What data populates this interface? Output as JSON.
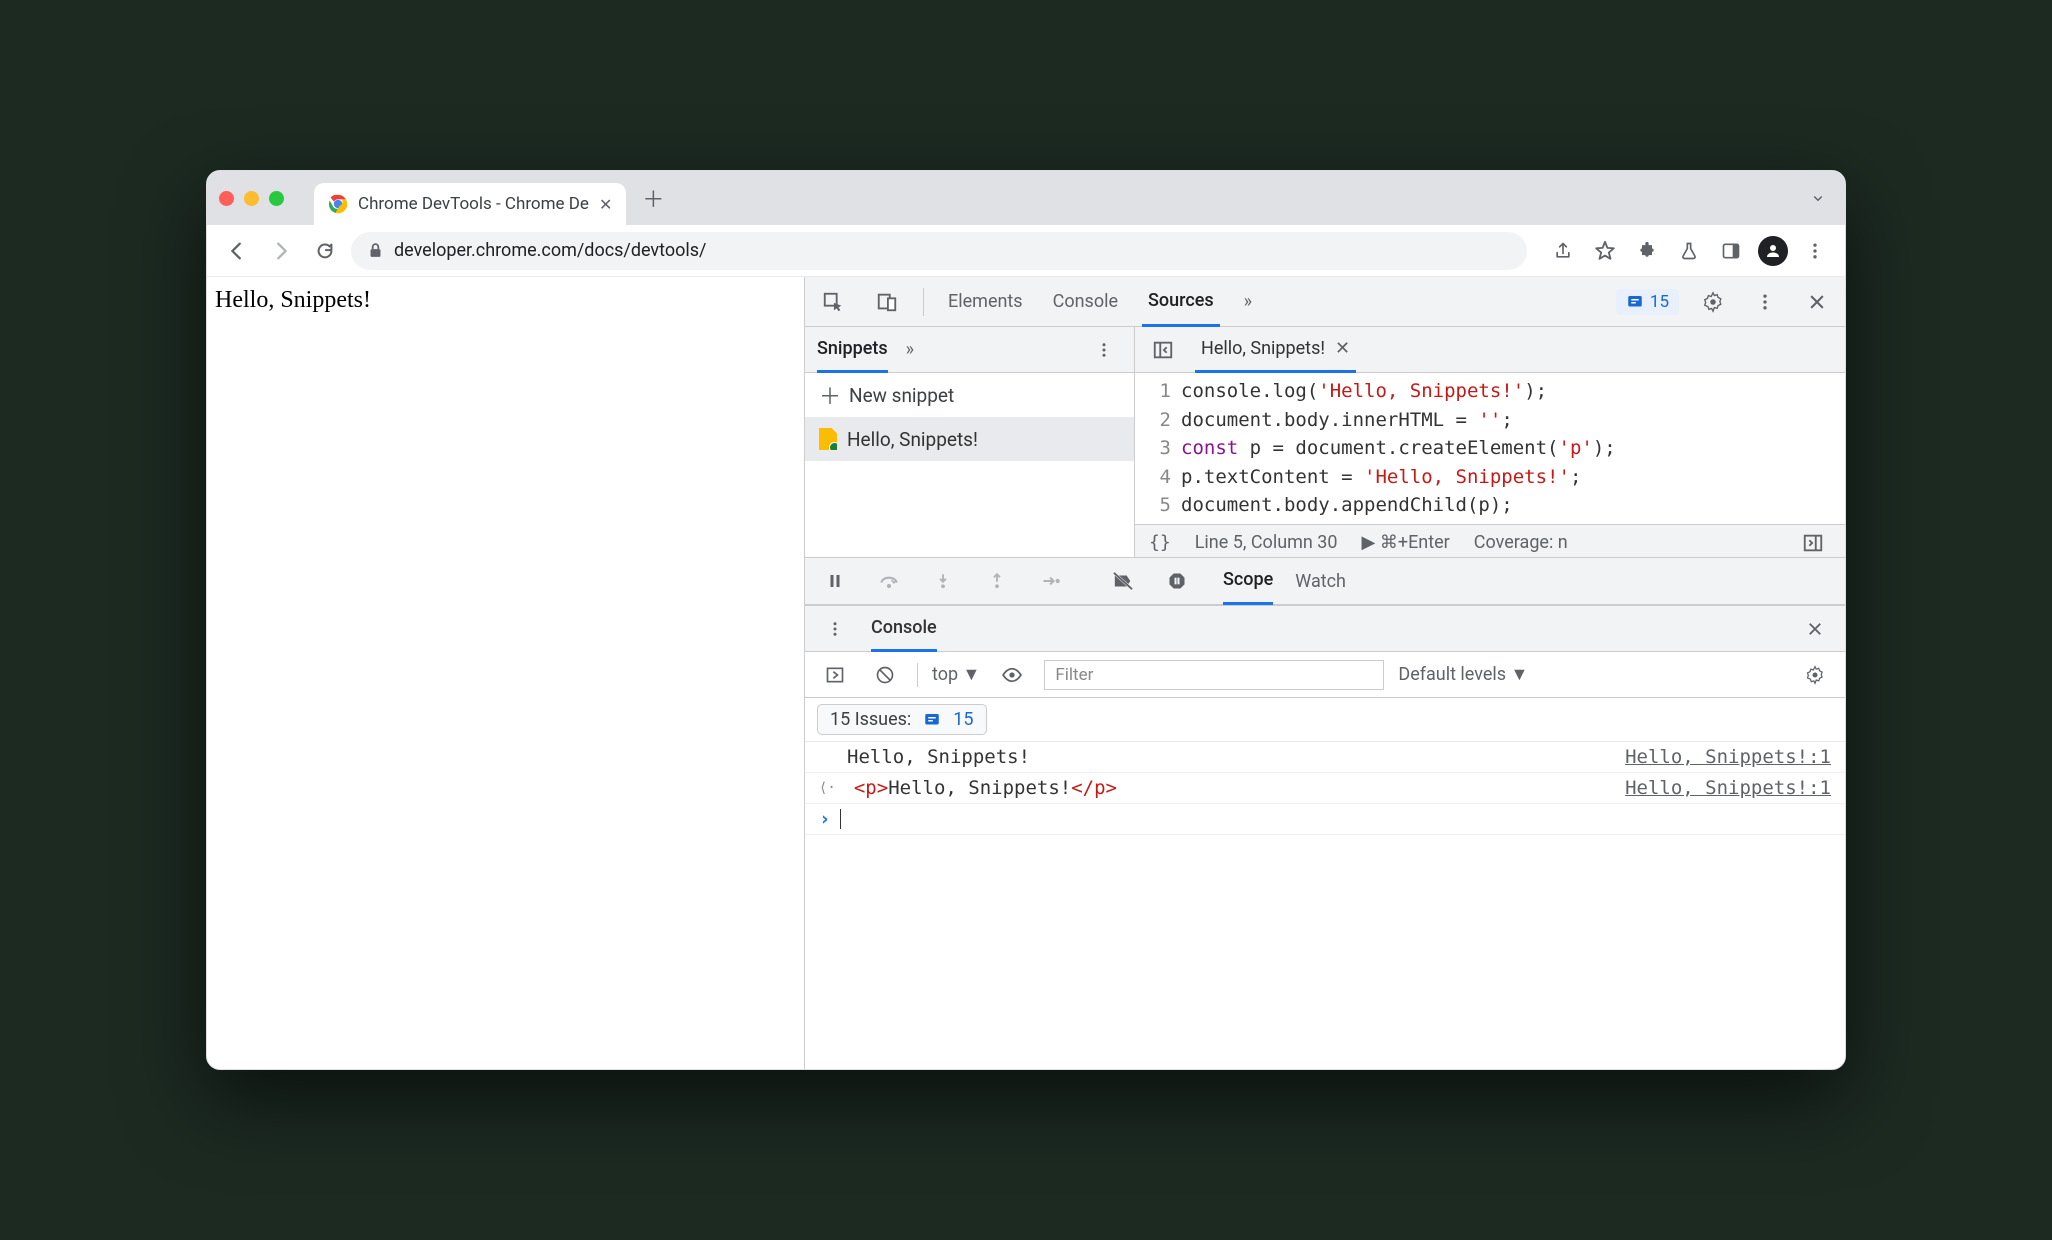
{
  "browser": {
    "tab_title": "Chrome DevTools - Chrome De",
    "new_tab_icon": "plus",
    "url": "developer.chrome.com/docs/devtools/"
  },
  "page": {
    "body_text": "Hello, Snippets!"
  },
  "devtools": {
    "tabs": {
      "elements": "Elements",
      "console": "Console",
      "sources": "Sources",
      "more": "»"
    },
    "issues_count": "15",
    "snippets": {
      "tab_label": "Snippets",
      "new_snippet": "New snippet",
      "items": [
        "Hello, Snippets!"
      ]
    },
    "editor": {
      "open_file": "Hello, Snippets!",
      "lines": [
        {
          "n": "1",
          "pre": "console.log(",
          "str": "'Hello, Snippets!'",
          "post": ");"
        },
        {
          "n": "2",
          "pre": "document.body.innerHTML = ",
          "str": "''",
          "post": ";"
        },
        {
          "n": "3",
          "kw": "const",
          "mid": " p = document.createElement(",
          "str": "'p'",
          "post": ");"
        },
        {
          "n": "4",
          "pre": "p.textContent = ",
          "str": "'Hello, Snippets!'",
          "post": ";"
        },
        {
          "n": "5",
          "pre": "document.body.appendChild(p);",
          "str": "",
          "post": ""
        }
      ],
      "status": {
        "braces": "{}",
        "cursor": "Line 5, Column 30",
        "run": "▶ ⌘+Enter",
        "coverage": "Coverage: n"
      }
    },
    "debugger": {
      "scope": "Scope",
      "watch": "Watch"
    },
    "drawer": {
      "console_label": "Console",
      "context": "top ▼",
      "filter_placeholder": "Filter",
      "levels": "Default levels ▼",
      "issues_label": "15 Issues:",
      "issues_badge": "15",
      "rows": [
        {
          "text": "Hello, Snippets!",
          "link": "Hello, Snippets!:1",
          "indent": true
        },
        {
          "html_pre": "<p>",
          "html_mid": "Hello, Snippets!",
          "html_post": "</p>",
          "link": "Hello, Snippets!:1",
          "return": true
        }
      ]
    }
  }
}
